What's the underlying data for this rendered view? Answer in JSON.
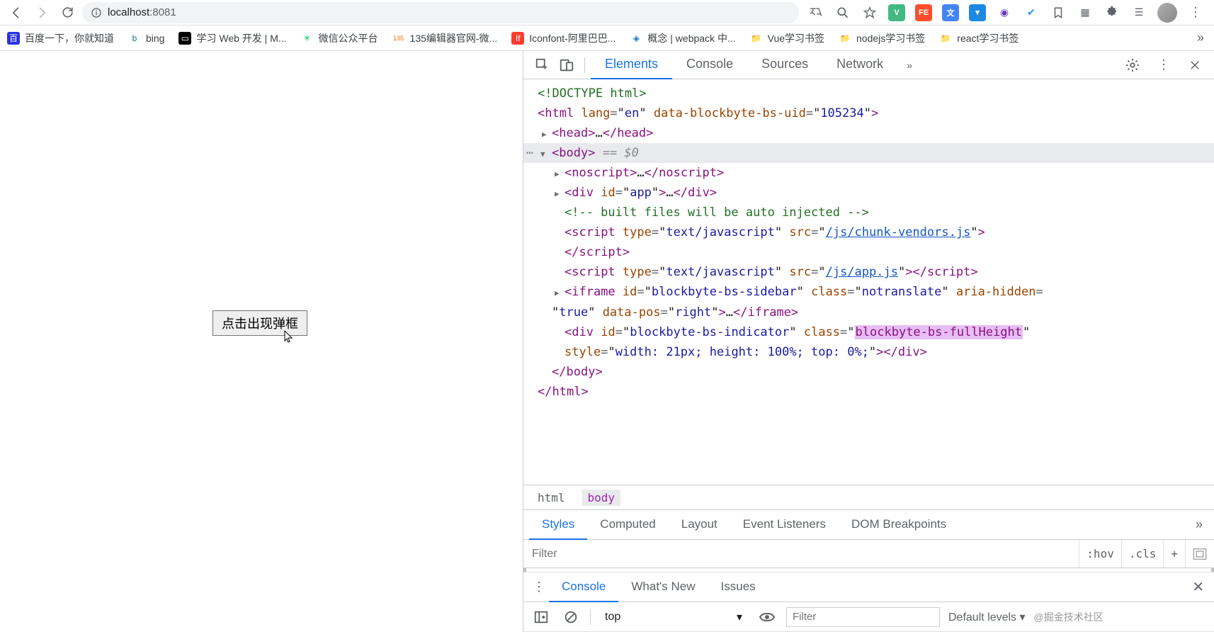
{
  "browser": {
    "url_host": "localhost",
    "url_port": ":8081",
    "bookmarks": [
      {
        "label": "百度一下，你就知道",
        "icon_bg": "#2932e1",
        "icon_fg": "#fff",
        "glyph": "百"
      },
      {
        "label": "bing",
        "icon_bg": "#ffffff",
        "icon_fg": "#008373",
        "glyph": "b"
      },
      {
        "label": "学习 Web 开发 | M...",
        "icon_bg": "#000000",
        "icon_fg": "#fff",
        "glyph": "⬚"
      },
      {
        "label": "微信公众平台",
        "icon_bg": "#ffffff",
        "icon_fg": "#07c160",
        "glyph": "✳"
      },
      {
        "label": "135编辑器官网-微...",
        "icon_bg": "#ffffff",
        "icon_fg": "#ff6a00",
        "glyph": "135"
      },
      {
        "label": "Iconfont-阿里巴巴...",
        "icon_bg": "#ff3b30",
        "icon_fg": "#fff",
        "glyph": "If"
      },
      {
        "label": "概念 | webpack 中...",
        "icon_bg": "#ffffff",
        "icon_fg": "#1c78c0",
        "glyph": "◈"
      },
      {
        "label": "Vue学习书签",
        "icon_bg": "#ffe082",
        "icon_fg": "#a07b00",
        "glyph": "📁"
      },
      {
        "label": "nodejs学习书签",
        "icon_bg": "#ffe082",
        "icon_fg": "#a07b00",
        "glyph": "📁"
      },
      {
        "label": "react学习书签",
        "icon_bg": "#ffe082",
        "icon_fg": "#a07b00",
        "glyph": "📁"
      }
    ]
  },
  "page": {
    "button_label": "点击出现弹框"
  },
  "devtools": {
    "tabs": [
      "Elements",
      "Console",
      "Sources",
      "Network"
    ],
    "active_tab": "Elements",
    "dom": {
      "doctype": "<!DOCTYPE html>",
      "html_attrs": {
        "lang": "en",
        "data-blockbyte-bs-uid": "105234"
      },
      "body_suffix": " == $0",
      "comment": "<!-- built files will be auto injected -->",
      "script1_src": "/js/chunk-vendors.js",
      "script2_src": "/js/app.js",
      "iframe": {
        "id": "blockbyte-bs-sidebar",
        "class": "notranslate",
        "aria_hidden": "true",
        "data_pos": "right"
      },
      "indicator": {
        "id": "blockbyte-bs-indicator",
        "class": "blockbyte-bs-fullHeight",
        "style": "width: 21px; height: 100%; top: 0%;"
      }
    },
    "crumbs": [
      "html",
      "body"
    ],
    "active_crumb": "body",
    "styles_tabs": [
      "Styles",
      "Computed",
      "Layout",
      "Event Listeners",
      "DOM Breakpoints"
    ],
    "active_styles_tab": "Styles",
    "filter_placeholder": "Filter",
    "filter_btns": {
      "hov": ":hov",
      "cls": ".cls",
      "plus": "+"
    },
    "drawer_tabs": [
      "Console",
      "What's New",
      "Issues"
    ],
    "active_drawer_tab": "Console",
    "console": {
      "context": "top",
      "filter_placeholder": "Filter",
      "levels": "Default levels ▾"
    },
    "watermark": "@掘金技术社区"
  }
}
